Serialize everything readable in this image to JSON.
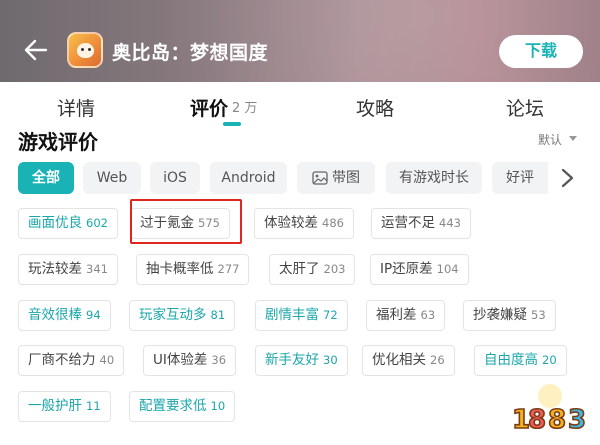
{
  "header": {
    "app_title": "奥比岛：梦想国度",
    "download_label": "下载"
  },
  "tabs": [
    {
      "label": "详情"
    },
    {
      "label": "评价",
      "count": "2 万"
    },
    {
      "label": "攻略"
    },
    {
      "label": "论坛"
    }
  ],
  "section": {
    "title": "游戏评价",
    "sort_label": "默认"
  },
  "filters": [
    "全部",
    "Web",
    "iOS",
    "Android",
    "带图",
    "有游戏时长",
    "好评"
  ],
  "tags": [
    {
      "label": "画面优良",
      "count": "602",
      "sentiment": "positive"
    },
    {
      "label": "过于氪金",
      "count": "575",
      "sentiment": "negative"
    },
    {
      "label": "体验较差",
      "count": "486",
      "sentiment": "negative"
    },
    {
      "label": "运营不足",
      "count": "443",
      "sentiment": "negative"
    },
    {
      "label": "玩法较差",
      "count": "341",
      "sentiment": "negative"
    },
    {
      "label": "抽卡概率低",
      "count": "277",
      "sentiment": "negative"
    },
    {
      "label": "太肝了",
      "count": "203",
      "sentiment": "negative"
    },
    {
      "label": "IP还原差",
      "count": "104",
      "sentiment": "negative"
    },
    {
      "label": "音效很棒",
      "count": "94",
      "sentiment": "positive"
    },
    {
      "label": "玩家互动多",
      "count": "81",
      "sentiment": "positive"
    },
    {
      "label": "剧情丰富",
      "count": "72",
      "sentiment": "positive"
    },
    {
      "label": "福利差",
      "count": "63",
      "sentiment": "negative"
    },
    {
      "label": "抄袭嫌疑",
      "count": "53",
      "sentiment": "negative"
    },
    {
      "label": "厂商不给力",
      "count": "40",
      "sentiment": "negative"
    },
    {
      "label": "UI体验差",
      "count": "36",
      "sentiment": "negative"
    },
    {
      "label": "新手友好",
      "count": "30",
      "sentiment": "positive"
    },
    {
      "label": "优化相关",
      "count": "26",
      "sentiment": "negative"
    },
    {
      "label": "自由度高",
      "count": "20",
      "sentiment": "positive"
    },
    {
      "label": "一般护肝",
      "count": "11",
      "sentiment": "positive"
    },
    {
      "label": "配置要求低",
      "count": "10",
      "sentiment": "positive"
    }
  ],
  "colors": {
    "accent": "#19b2b5",
    "highlight": "#e0251f"
  },
  "watermark": {
    "text": "1883"
  }
}
